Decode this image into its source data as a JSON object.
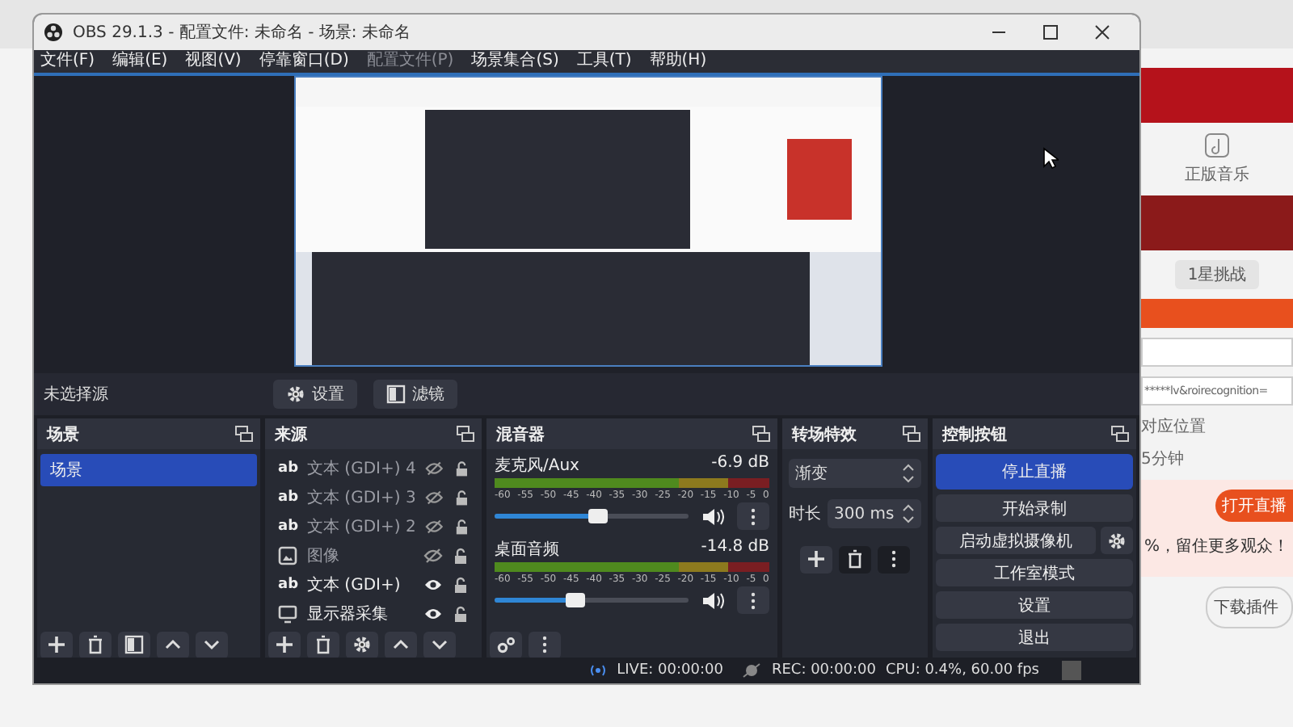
{
  "window": {
    "title": "OBS 29.1.3 - 配置文件: 未命名 - 场景: 未命名"
  },
  "menu": [
    {
      "label": "文件(F)",
      "disabled": false
    },
    {
      "label": "编辑(E)",
      "disabled": false
    },
    {
      "label": "视图(V)",
      "disabled": false
    },
    {
      "label": "停靠窗口(D)",
      "disabled": false
    },
    {
      "label": "配置文件(P)",
      "disabled": true
    },
    {
      "label": "场景集合(S)",
      "disabled": false
    },
    {
      "label": "工具(T)",
      "disabled": false
    },
    {
      "label": "帮助(H)",
      "disabled": false
    }
  ],
  "source_toolbar": {
    "label": "未选择源",
    "buttons": [
      {
        "kind": "settings",
        "label": "设置"
      },
      {
        "kind": "filters",
        "label": "滤镜"
      }
    ]
  },
  "scenes": {
    "title": "场景",
    "items": [
      {
        "name": "场景",
        "selected": true
      }
    ]
  },
  "sources": {
    "title": "来源",
    "items": [
      {
        "kind": "text",
        "icon": "ab",
        "name": "文本 (GDI+) 4",
        "visible": false
      },
      {
        "kind": "text",
        "icon": "ab",
        "name": "文本 (GDI+) 3",
        "visible": false
      },
      {
        "kind": "text",
        "icon": "ab",
        "name": "文本 (GDI+) 2",
        "visible": false
      },
      {
        "kind": "image",
        "name": "图像",
        "visible": false
      },
      {
        "kind": "text",
        "icon": "ab",
        "name": "文本 (GDI+)",
        "visible": true
      },
      {
        "kind": "display",
        "name": "显示器采集",
        "visible": true
      }
    ]
  },
  "mixer": {
    "title": "混音器",
    "channels": [
      {
        "name": "麦克风/Aux",
        "reading": "-6.9 dB",
        "level": 0.53,
        "scale": [
          "-60",
          "-55",
          "-50",
          "-45",
          "-40",
          "-35",
          "-30",
          "-25",
          "-20",
          "-15",
          "-10",
          "-5",
          "0"
        ]
      },
      {
        "name": "桌面音频",
        "reading": "-14.8 dB",
        "level": 0.42,
        "scale": [
          "-60",
          "-55",
          "-50",
          "-45",
          "-40",
          "-35",
          "-30",
          "-25",
          "-20",
          "-15",
          "-10",
          "-5",
          "0"
        ]
      }
    ]
  },
  "transitions": {
    "title": "转场特效",
    "selected": "渐变",
    "duration_label": "时长",
    "duration": "300 ms"
  },
  "controls": {
    "title": "控制按钮",
    "buttons": [
      {
        "label": "停止直播",
        "kind": "plain",
        "active": true
      },
      {
        "label": "开始录制",
        "kind": "plain",
        "active": false
      },
      {
        "label": "启动虚拟摄像机",
        "kind": "with_settings",
        "active": false
      },
      {
        "label": "工作室模式",
        "kind": "plain",
        "active": false
      },
      {
        "label": "设置",
        "kind": "plain",
        "active": false
      },
      {
        "label": "退出",
        "kind": "plain",
        "active": false
      }
    ]
  },
  "status_bar": {
    "live": "LIVE: 00:00:00",
    "rec": "REC: 00:00:00",
    "cpu": "CPU: 0.4%, 60.00 fps"
  },
  "background_window": {
    "icon_label": "正版音乐",
    "challenge_button": "1星挑战",
    "url_field": "*****lv&roirecognition=",
    "hint_1": "对应位置",
    "hint_2": "5分钟",
    "open_button": "打开直播",
    "promo": "%，留住更多观众！",
    "download_button": "下载插件"
  }
}
